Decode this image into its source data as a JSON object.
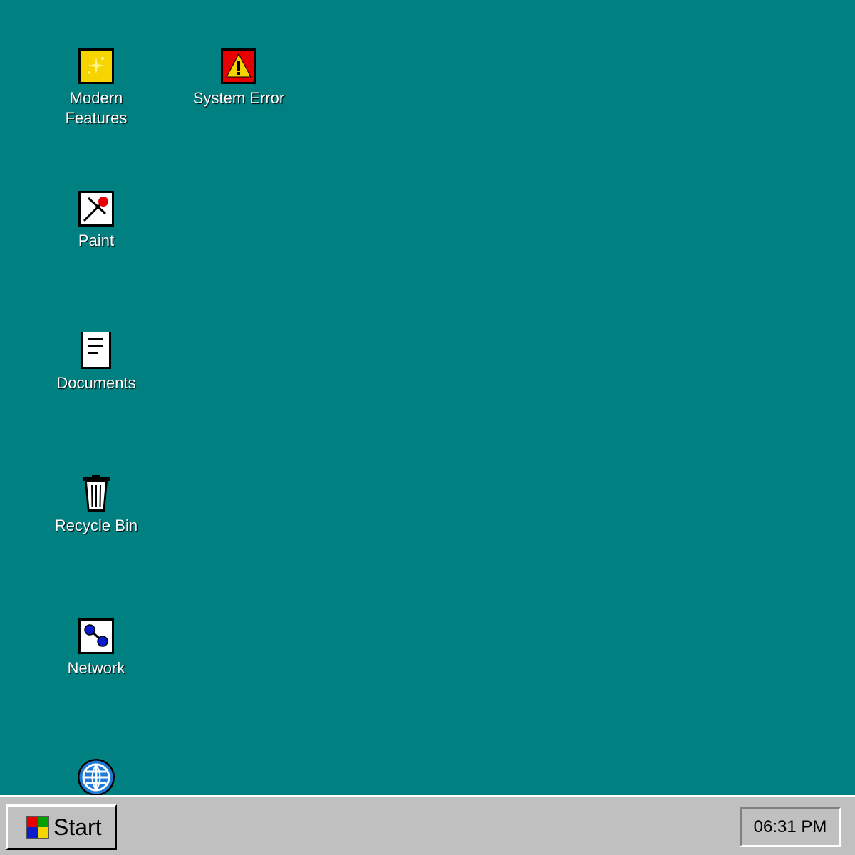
{
  "desktop": {
    "background_color": "#008080",
    "icons": [
      {
        "id": "modern-features",
        "label_line1": "Modern",
        "label_line2": "Features",
        "icon": "sparkle-icon"
      },
      {
        "id": "system-error",
        "label": "System Error",
        "icon": "warning-icon"
      },
      {
        "id": "paint",
        "label": "Paint",
        "icon": "paint-brush-icon"
      },
      {
        "id": "documents",
        "label": "Documents",
        "icon": "document-icon"
      },
      {
        "id": "recycle-bin",
        "label": "Recycle Bin",
        "icon": "trash-icon"
      },
      {
        "id": "network",
        "label": "Network",
        "icon": "network-icon"
      },
      {
        "id": "globe",
        "label": "",
        "icon": "globe-icon"
      }
    ]
  },
  "taskbar": {
    "start_label": "Start",
    "clock": "06:31 PM"
  }
}
